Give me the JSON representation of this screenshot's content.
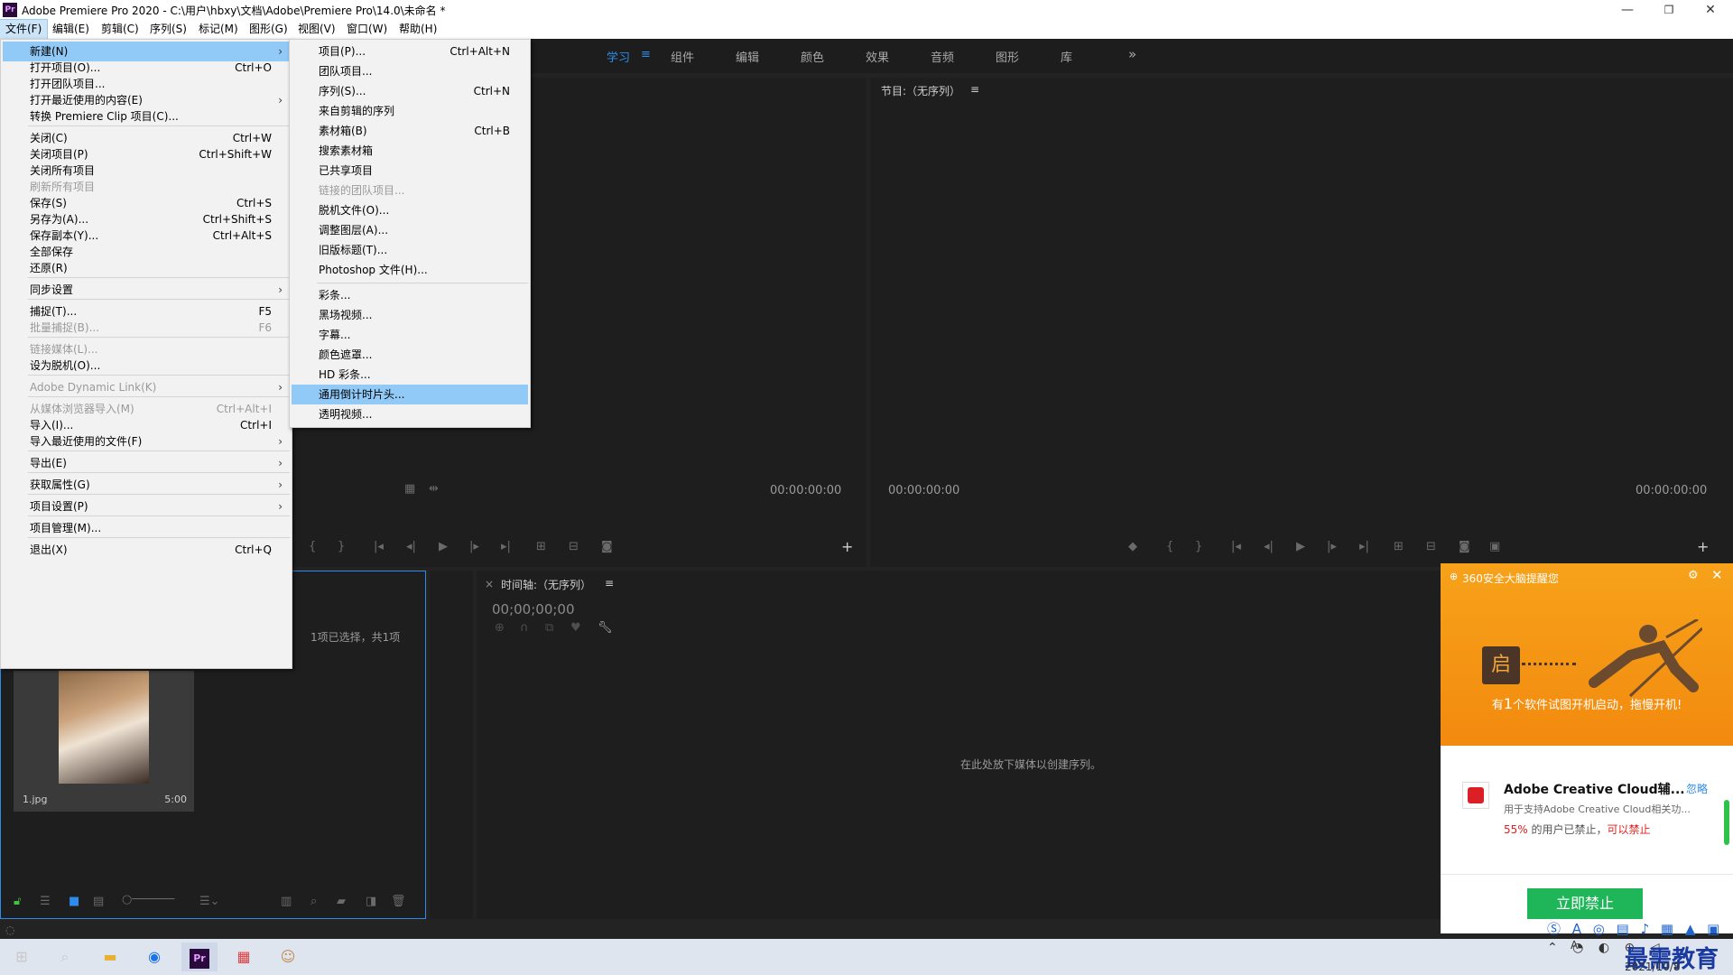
{
  "window": {
    "title": "Adobe Premiere Pro 2020 - C:\\用户\\hbxy\\文档\\Adobe\\Premiere Pro\\14.0\\未命名 *",
    "minimize": "—",
    "maximize": "❐",
    "close": "✕"
  },
  "menubar": [
    "文件(F)",
    "编辑(E)",
    "剪辑(C)",
    "序列(S)",
    "标记(M)",
    "图形(G)",
    "视图(V)",
    "窗口(W)",
    "帮助(H)"
  ],
  "workspaces": {
    "items": [
      "学习",
      "组件",
      "编辑",
      "颜色",
      "效果",
      "音频",
      "图形",
      "库"
    ],
    "active_menu_icon": "≡",
    "more": "»"
  },
  "source": {
    "tc_left": "00:00:00:00"
  },
  "program": {
    "title": "节目:（无序列）",
    "menu_icon": "≡",
    "tc_left": "00:00:00:00",
    "tc_right": "00:00:00:00"
  },
  "project": {
    "selection": "1项已选择，共1项",
    "clip_name": "1.jpg",
    "clip_duration": "5:00"
  },
  "timeline": {
    "title": "时间轴:（无序列）",
    "close": "×",
    "menu_icon": "≡",
    "timecode": "00;00;00;00",
    "empty_hint": "在此处放下媒体以创建序列。"
  },
  "file_menu": [
    {
      "label": "新建(N)",
      "shortcut": "",
      "submenu": true,
      "state": "highlight"
    },
    {
      "label": "打开项目(O)...",
      "shortcut": "Ctrl+O"
    },
    {
      "label": "打开团队项目...",
      "shortcut": ""
    },
    {
      "label": "打开最近使用的内容(E)",
      "shortcut": "",
      "submenu": true
    },
    {
      "label": "转换 Premiere Clip 项目(C)...",
      "shortcut": ""
    },
    {
      "sep": true
    },
    {
      "label": "关闭(C)",
      "shortcut": "Ctrl+W"
    },
    {
      "label": "关闭项目(P)",
      "shortcut": "Ctrl+Shift+W"
    },
    {
      "label": "关闭所有项目",
      "shortcut": ""
    },
    {
      "label": "刷新所有项目",
      "shortcut": "",
      "state": "disabled"
    },
    {
      "label": "保存(S)",
      "shortcut": "Ctrl+S"
    },
    {
      "label": "另存为(A)...",
      "shortcut": "Ctrl+Shift+S"
    },
    {
      "label": "保存副本(Y)...",
      "shortcut": "Ctrl+Alt+S"
    },
    {
      "label": "全部保存",
      "shortcut": ""
    },
    {
      "label": "还原(R)",
      "shortcut": ""
    },
    {
      "sep": true
    },
    {
      "label": "同步设置",
      "shortcut": "",
      "submenu": true
    },
    {
      "sep": true
    },
    {
      "label": "捕捉(T)...",
      "shortcut": "F5"
    },
    {
      "label": "批量捕捉(B)...",
      "shortcut": "F6",
      "state": "disabled"
    },
    {
      "sep": true
    },
    {
      "label": "链接媒体(L)...",
      "shortcut": "",
      "state": "disabled"
    },
    {
      "label": "设为脱机(O)...",
      "shortcut": ""
    },
    {
      "sep": true
    },
    {
      "label": "Adobe Dynamic Link(K)",
      "shortcut": "",
      "submenu": true,
      "state": "disabled"
    },
    {
      "sep": true
    },
    {
      "label": "从媒体浏览器导入(M)",
      "shortcut": "Ctrl+Alt+I",
      "state": "disabled"
    },
    {
      "label": "导入(I)...",
      "shortcut": "Ctrl+I"
    },
    {
      "label": "导入最近使用的文件(F)",
      "shortcut": "",
      "submenu": true
    },
    {
      "sep": true
    },
    {
      "label": "导出(E)",
      "shortcut": "",
      "submenu": true
    },
    {
      "sep": true
    },
    {
      "label": "获取属性(G)",
      "shortcut": "",
      "submenu": true
    },
    {
      "sep": true
    },
    {
      "label": "项目设置(P)",
      "shortcut": "",
      "submenu": true
    },
    {
      "sep": true
    },
    {
      "label": "项目管理(M)...",
      "shortcut": ""
    },
    {
      "sep": true
    },
    {
      "label": "退出(X)",
      "shortcut": "Ctrl+Q"
    }
  ],
  "new_menu": [
    {
      "label": "项目(P)...",
      "shortcut": "Ctrl+Alt+N"
    },
    {
      "label": "团队项目...",
      "shortcut": ""
    },
    {
      "label": "序列(S)...",
      "shortcut": "Ctrl+N"
    },
    {
      "label": "来自剪辑的序列",
      "shortcut": ""
    },
    {
      "label": "素材箱(B)",
      "shortcut": "Ctrl+B"
    },
    {
      "label": "搜索素材箱",
      "shortcut": ""
    },
    {
      "label": "已共享项目",
      "shortcut": ""
    },
    {
      "label": "链接的团队项目...",
      "shortcut": "",
      "state": "disabled"
    },
    {
      "label": "脱机文件(O)...",
      "shortcut": ""
    },
    {
      "label": "调整图层(A)...",
      "shortcut": ""
    },
    {
      "label": "旧版标题(T)...",
      "shortcut": ""
    },
    {
      "label": "Photoshop 文件(H)...",
      "shortcut": ""
    },
    {
      "sep": true
    },
    {
      "label": "彩条...",
      "shortcut": ""
    },
    {
      "label": "黑场视频...",
      "shortcut": ""
    },
    {
      "label": "字幕...",
      "shortcut": ""
    },
    {
      "label": "颜色遮罩...",
      "shortcut": ""
    },
    {
      "label": "HD 彩条...",
      "shortcut": ""
    },
    {
      "label": "通用倒计时片头...",
      "shortcut": "",
      "state": "highlight"
    },
    {
      "label": "透明视频...",
      "shortcut": ""
    }
  ],
  "popup": {
    "header": "360安全大脑提醒您",
    "lock_char": "启",
    "message_prefix": "有",
    "message_count": "1",
    "message_suffix": "个软件试图开机启动，拖慢开机!",
    "app_name": "Adobe Creative Cloud辅...",
    "ignore": "忽略",
    "desc": "用于支持Adobe Creative Cloud相关功...",
    "stat_pct": "55%",
    "stat_text": " 的用户已禁止，",
    "stat_link": "可以禁止",
    "button": "立即禁止"
  },
  "taskbar": {
    "date": "2021/10/8",
    "watermark": "最需教育",
    "ime_char": "A"
  },
  "colors": {
    "accent_blue": "#2d8ceb",
    "menu_highlight": "#91c9f7",
    "popup_orange": "#f5961a",
    "popup_green": "#1fb65a"
  }
}
